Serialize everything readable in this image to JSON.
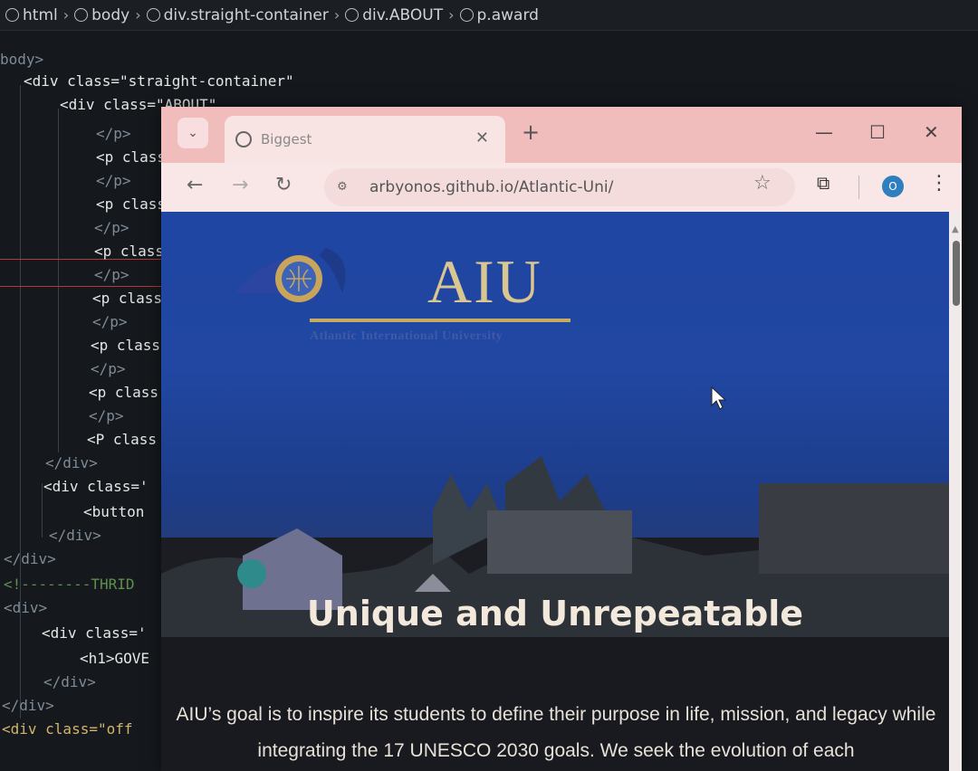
{
  "editor": {
    "breadcrumb": [
      {
        "label": "html"
      },
      {
        "label": "body"
      },
      {
        "label": "div.straight-container"
      },
      {
        "label": "div.ABOUT"
      },
      {
        "label": "p.award"
      }
    ],
    "lines": [
      {
        "text": "body>",
        "kind": "tag"
      },
      {
        "text": "<div class=\"straight-container\"",
        "kind": "code"
      },
      {
        "text": "<div class=\"ABOUT\"",
        "kind": "code"
      },
      {
        "text": "</p>",
        "kind": "tag"
      },
      {
        "text": "<p class",
        "kind": "code"
      },
      {
        "text": "</p>",
        "kind": "tag"
      },
      {
        "text": "<p class",
        "kind": "code"
      },
      {
        "text": "</p>",
        "kind": "tag"
      },
      {
        "text": "<p class",
        "kind": "code"
      },
      {
        "text": "</p>",
        "kind": "tag"
      },
      {
        "text": "<p class",
        "kind": "code"
      },
      {
        "text": "</p>",
        "kind": "tag"
      },
      {
        "text": "<p class",
        "kind": "code"
      },
      {
        "text": "</p>",
        "kind": "tag"
      },
      {
        "text": "<p class",
        "kind": "code"
      },
      {
        "text": "</p>",
        "kind": "tag"
      },
      {
        "text": "<P class",
        "kind": "code"
      },
      {
        "text": "</div>",
        "kind": "tag"
      },
      {
        "text": "<div class='",
        "kind": "code"
      },
      {
        "text": "<button",
        "kind": "code"
      },
      {
        "text": "</div>",
        "kind": "tag"
      },
      {
        "text": "</div>",
        "kind": "tag"
      },
      {
        "text": "<!--------THRID",
        "kind": "comment"
      },
      {
        "text": "<div>",
        "kind": "tag"
      },
      {
        "text": "<div class='",
        "kind": "code"
      },
      {
        "text": "<h1>GOVE",
        "kind": "code"
      },
      {
        "text": "</div>",
        "kind": "tag"
      },
      {
        "text": "</div>",
        "kind": "tag"
      },
      {
        "text": "<div class=\"off",
        "kind": "code"
      }
    ]
  },
  "browser": {
    "tab_title": "Biggest",
    "address": "arbyonos.github.io/Atlantic-Uni/",
    "profile_initial": "O"
  },
  "page": {
    "logo": {
      "acronym": "AIU",
      "full_name": "Atlantic International University"
    },
    "hero_title": "Unique and Unrepeatable",
    "hero_body": "AIU’s goal is to inspire its students to define their purpose in life, mission, and legacy while integrating the 17 UNESCO 2030 goals. We seek the evolution of each"
  },
  "colors": {
    "logo_gold": "#dac690",
    "logo_blue": "#3f5aa7",
    "sky_blue": "#1f46a3",
    "hero_text": "#f2e9dc"
  }
}
